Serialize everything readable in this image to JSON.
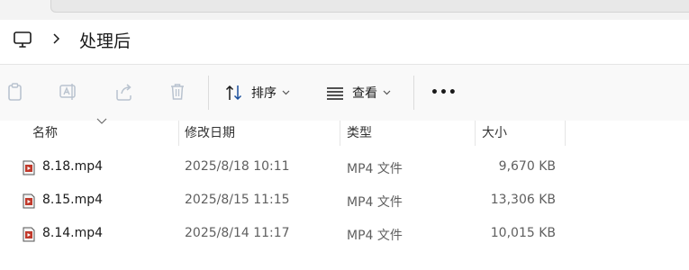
{
  "breadcrumb": {
    "current": "处理后"
  },
  "toolbar": {
    "sort_label": "排序",
    "view_label": "查看",
    "more_label": "•••"
  },
  "columns": {
    "name": "名称",
    "date": "修改日期",
    "type": "类型",
    "size": "大小"
  },
  "files": [
    {
      "name": "8.18.mp4",
      "date": "2025/8/18 10:11",
      "type": "MP4 文件",
      "size": "9,670 KB"
    },
    {
      "name": "8.15.mp4",
      "date": "2025/8/15 11:15",
      "type": "MP4 文件",
      "size": "13,306 KB"
    },
    {
      "name": "8.14.mp4",
      "date": "2025/8/14 11:17",
      "type": "MP4 文件",
      "size": "10,015 KB"
    }
  ],
  "colors": {
    "toolbar_bg": "#f9f9f9",
    "icon_disabled": "#b9c3cf",
    "file_icon_red": "#c0392b"
  }
}
